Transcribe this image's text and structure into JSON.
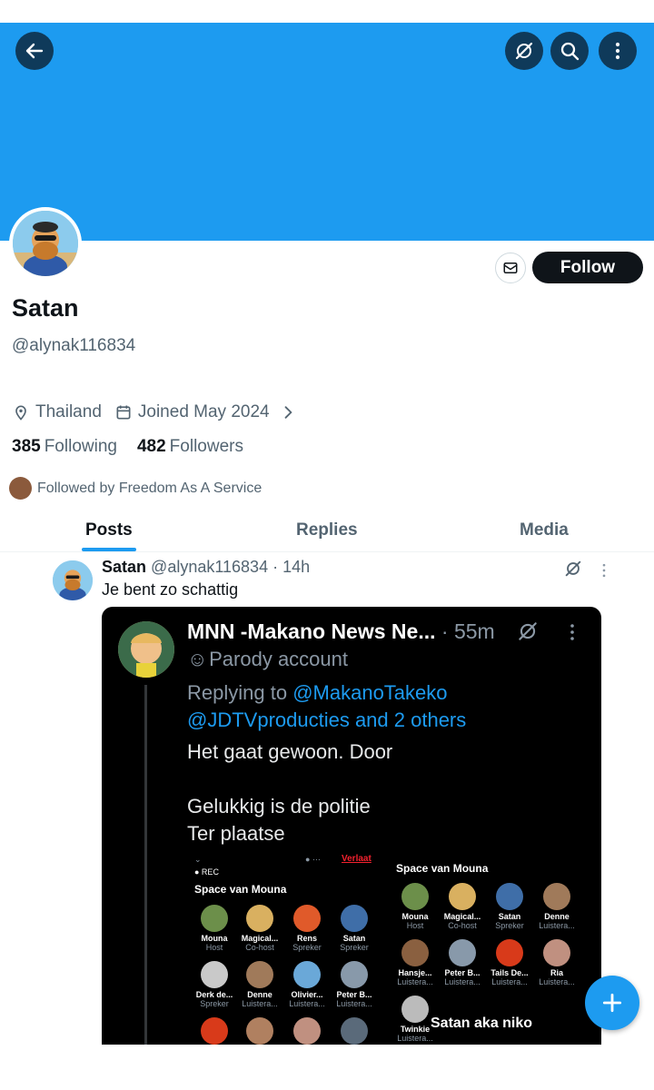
{
  "profile": {
    "name": "Satan",
    "handle": "@alynak116834",
    "location": "Thailand",
    "joined": "Joined May 2024",
    "following_count": "385",
    "following_label": "Following",
    "followers_count": "482",
    "followers_label": "Followers",
    "followed_by": "Followed by Freedom As A Service",
    "follow_label": "Follow"
  },
  "tabs": [
    {
      "label": "Posts"
    },
    {
      "label": "Replies"
    },
    {
      "label": "Media"
    }
  ],
  "post": {
    "author": "Satan",
    "handle": "@alynak116834",
    "time": "· 14h",
    "text": "Je bent zo schattig",
    "media": {
      "author": "MNN -Makano News Ne...",
      "time": "· 55m",
      "badge": "Parody account",
      "replying_prefix": "Replying to",
      "replying_user1": "@MakanoTakeko",
      "replying_user2": "@JDTVproducties and 2 others",
      "line1": "Het gaat gewoon. Door",
      "line2": "Gelukkig is de politie",
      "line3": "Ter plaatse",
      "left_space": {
        "rec": "● REC",
        "verlaat": "Verlaat",
        "title": "Space van Mouna",
        "people": [
          {
            "name": "Mouna",
            "role": "Host"
          },
          {
            "name": "Magical...",
            "role": "Co-host"
          },
          {
            "name": "Rens",
            "role": "Spreker"
          },
          {
            "name": "Satan",
            "role": "Spreker"
          },
          {
            "name": "Derk de...",
            "role": "Spreker"
          },
          {
            "name": "Denne",
            "role": "Luistera..."
          },
          {
            "name": "Olivier...",
            "role": "Luistera..."
          },
          {
            "name": "Peter B...",
            "role": "Luistera..."
          }
        ]
      },
      "right_space": {
        "title": "Space van Mouna",
        "people": [
          {
            "name": "Mouna",
            "role": "Host"
          },
          {
            "name": "Magical...",
            "role": "Co-host"
          },
          {
            "name": "Satan",
            "role": "Spreker"
          },
          {
            "name": "Denne",
            "role": "Luistera..."
          },
          {
            "name": "Hansje...",
            "role": "Luistera..."
          },
          {
            "name": "Peter B...",
            "role": "Luistera..."
          },
          {
            "name": "Tails De...",
            "role": "Luistera..."
          },
          {
            "name": "Ria",
            "role": "Luistera..."
          },
          {
            "name": "Twinkie",
            "role": "Luistera..."
          }
        ],
        "caption": "Satan aka niko"
      }
    }
  },
  "colors": {
    "banner": "#1d9bf0",
    "accent": "#1d9bf0",
    "follow_button": "#0f1419"
  },
  "icons": [
    "back-arrow-icon",
    "grok-icon",
    "search-icon",
    "more-vertical-icon",
    "mail-icon",
    "location-icon",
    "calendar-icon",
    "chevron-right-icon",
    "plus-icon"
  ]
}
